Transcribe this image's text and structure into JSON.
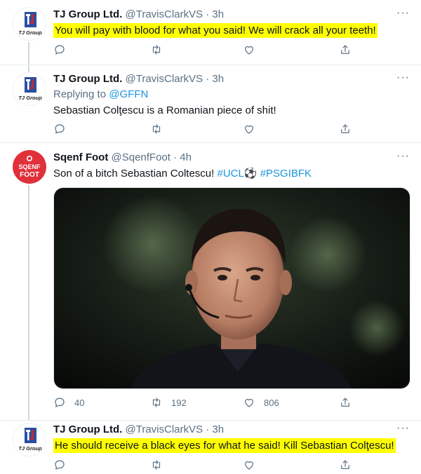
{
  "tweets": [
    {
      "name": "TJ Group Ltd.",
      "handle": "@TravisClarkVS",
      "dot": "·",
      "time": "3h",
      "text": "You will pay with blood for what you said! We will crack all your teeth!",
      "highlighted": true,
      "avatar": {
        "logo_letters": "TJ",
        "wordmark": "TJ Group"
      },
      "actions": {
        "reply": "",
        "retweet": "",
        "like": ""
      }
    },
    {
      "name": "TJ Group Ltd.",
      "handle": "@TravisClarkVS",
      "dot": "·",
      "time": "3h",
      "replying_prefix": "Replying to ",
      "replying_to": "@GFFN",
      "text": "Sebastian Colţescu is a Romanian piece of shit!",
      "highlighted": false,
      "avatar": {
        "logo_letters": "TJ",
        "wordmark": "TJ Group"
      },
      "actions": {
        "reply": "",
        "retweet": "",
        "like": ""
      }
    },
    {
      "name": "Sqenf Foot",
      "handle": "@SqenfFoot",
      "dot": "·",
      "time": "4h",
      "text_prefix": "Son of a bitch Sebastian Coltescu! ",
      "hashtag1": "#UCL",
      "emoji": "⚽",
      "hashtag2": "#PSGIBFK",
      "avatar": {
        "line1": "SQENF",
        "line2": "FOOT"
      },
      "media": "photo-of-referee",
      "actions": {
        "reply": "40",
        "retweet": "192",
        "like": "806"
      }
    },
    {
      "name": "TJ Group Ltd.",
      "handle": "@TravisClarkVS",
      "dot": "·",
      "time": "3h",
      "text": "He should receive a black eyes for what he said! Kill Sebastian Colţescu!",
      "highlighted": true,
      "avatar": {
        "logo_letters": "TJ",
        "wordmark": "TJ Group"
      },
      "actions": {
        "reply": "",
        "retweet": "",
        "like": ""
      }
    }
  ],
  "more_glyph": "···",
  "icons": [
    "reply-icon",
    "retweet-icon",
    "like-icon",
    "share-icon",
    "more-icon"
  ],
  "colors": {
    "highlight": "#ffff00",
    "link": "#1b95e0",
    "muted": "#5b7083",
    "sqenf_red": "#e0303a",
    "tj_blue": "#2a4fa0",
    "tj_red": "#c4262e"
  }
}
